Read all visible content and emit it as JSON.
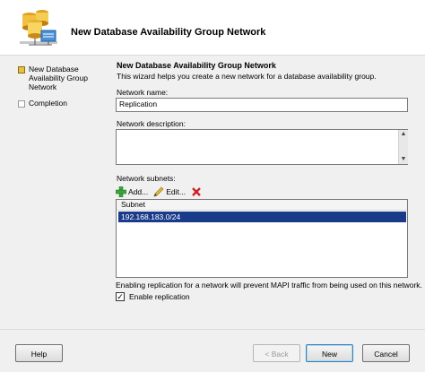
{
  "header": {
    "title": "New Database Availability Group Network"
  },
  "steps": [
    {
      "label": "New Database Availability Group Network",
      "state": "active"
    },
    {
      "label": "Completion",
      "state": "pending"
    }
  ],
  "content": {
    "title": "New Database Availability Group Network",
    "description": "This wizard helps you create a new network for a database availability group.",
    "name_label": "Network name:",
    "name_value": "Replication",
    "description_label": "Network description:",
    "description_value": "",
    "subnets_label": "Network subnets:",
    "toolbar": {
      "add_label": "Add...",
      "edit_label": "Edit..."
    },
    "subnets_table": {
      "column_header": "Subnet",
      "rows": [
        "192.168.183.0/24"
      ]
    },
    "warning": "Enabling replication for a network will prevent MAPI traffic from being used on this network.",
    "enable_replication_label": "Enable replication",
    "enable_replication_checked": true
  },
  "footer": {
    "help_label": "Help",
    "back_label": "< Back",
    "next_label": "New",
    "cancel_label": "Cancel"
  },
  "colors": {
    "selection": "#1a3a8a",
    "active_step": "#e8c040"
  }
}
